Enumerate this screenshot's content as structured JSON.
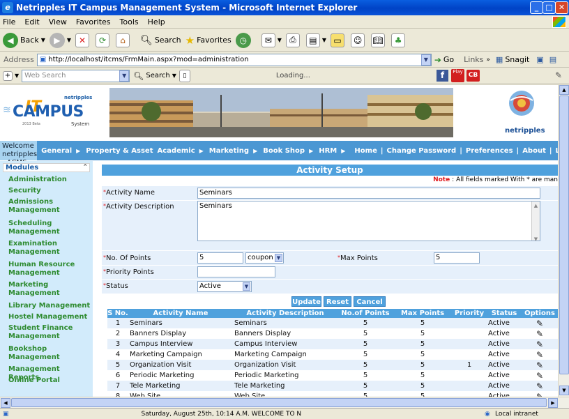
{
  "window": {
    "title": "Netripples IT Campus Management System - Microsoft Internet Explorer"
  },
  "menu": [
    "File",
    "Edit",
    "View",
    "Favorites",
    "Tools",
    "Help"
  ],
  "toolbar": {
    "back_label": "Back",
    "search_label": "Search",
    "favorites_label": "Favorites"
  },
  "address": {
    "label": "Address",
    "url": "http://localhost/itcms/FrmMain.aspx?mod=administration",
    "go_label": "Go",
    "links_label": "Links",
    "snagit_label": "Snagit"
  },
  "searchbar": {
    "placeholder": "Web Search",
    "search_label": "Search",
    "loading_text": "Loading...",
    "play_label": "Play",
    "cb_label": "CB"
  },
  "banner": {
    "logo_small": "netripples",
    "logo_it": "IT",
    "logo_campus": "CAMPUS",
    "logo_tag": "System",
    "logo_ver": "2013 Beta",
    "brand": "netripples"
  },
  "nav": {
    "welcome": "Welcome netripples - ACMS HQ Penang",
    "menus": [
      "General",
      "Property & Asset",
      "Academic",
      "Marketing",
      "Book Shop",
      "HRM"
    ],
    "links": [
      "Home",
      "Change Password",
      "Preferences",
      "About",
      "Lo"
    ]
  },
  "sidebar": {
    "title": "Modules",
    "items": [
      "Administration",
      "Security",
      "Admissions Management",
      "Scheduling Management",
      "Examination Management",
      "Human Resource Management",
      "Marketing Management",
      "Library Management",
      "Hostel Management",
      "Student Finance Management",
      "Bookshop Management",
      "Management Reports",
      "Online Portal"
    ]
  },
  "form": {
    "title": "Activity Setup",
    "note_label": "Note",
    "note_text": " : All fields marked With * are man",
    "activity_name_label": "Activity Name",
    "activity_name_value": "Seminars",
    "activity_desc_label": "Activity Description",
    "activity_desc_value": "Seminars",
    "points_label": "No. Of Points",
    "points_value": "5",
    "unit_value": "coupon",
    "max_points_label": "Max Points",
    "max_points_value": "5",
    "priority_label": "Priority Points",
    "priority_value": "",
    "status_label": "Status",
    "status_value": "Active",
    "update_label": "Update",
    "reset_label": "Reset",
    "cancel_label": "Cancel"
  },
  "table": {
    "headers": [
      "S No.",
      "Activity Name",
      "Activity Description",
      "No.of Points",
      "Max Points",
      "Priority",
      "Status",
      "Options"
    ],
    "rows": [
      [
        "1",
        "Seminars",
        "Seminars",
        "5",
        "5",
        "",
        "Active"
      ],
      [
        "2",
        "Banners Display",
        "Banners Display",
        "5",
        "5",
        "",
        "Active"
      ],
      [
        "3",
        "Campus Interview",
        "Campus Interview",
        "5",
        "5",
        "",
        "Active"
      ],
      [
        "4",
        "Marketing Campaign",
        "Marketing Campaign",
        "5",
        "5",
        "",
        "Active"
      ],
      [
        "5",
        "Organization Visit",
        "Organization Visit",
        "5",
        "5",
        "1",
        "Active"
      ],
      [
        "6",
        "Periodic Marketing",
        "Periodic Marketing",
        "5",
        "5",
        "",
        "Active"
      ],
      [
        "7",
        "Tele Marketing",
        "Tele Marketing",
        "5",
        "5",
        "",
        "Active"
      ],
      [
        "8",
        "Web Site",
        "Web Site",
        "5",
        "5",
        "",
        "Active"
      ]
    ]
  },
  "status": {
    "text": "Saturday, August 25th,  10:14 A.M.     WELCOME TO N",
    "zone": "Local intranet"
  }
}
